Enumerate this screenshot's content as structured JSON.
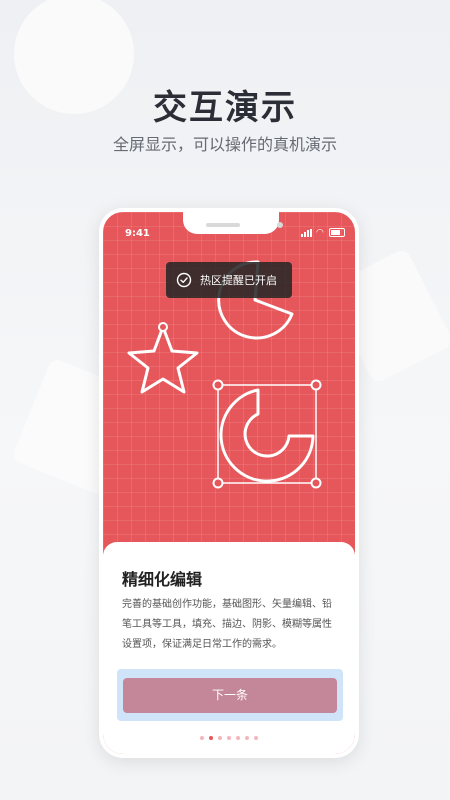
{
  "header": {
    "title": "交互演示",
    "subtitle": "全屏显示，可以操作的真机演示"
  },
  "phone": {
    "status_time": "9:41",
    "toast_text": "热区提醒已开启",
    "card": {
      "title": "精细化编辑",
      "description": "完善的基础创作功能，基础图形、矢量编辑、铅笔工具等工具，填充、描边、阴影、模糊等属性设置项，保证满足日常工作的需求。",
      "next_label": "下一条"
    },
    "pagination": {
      "total": 7,
      "current": 2
    }
  },
  "colors": {
    "brand_red": "#e5575a",
    "button": "#c4879a",
    "highlight": "#cfe4f8"
  }
}
